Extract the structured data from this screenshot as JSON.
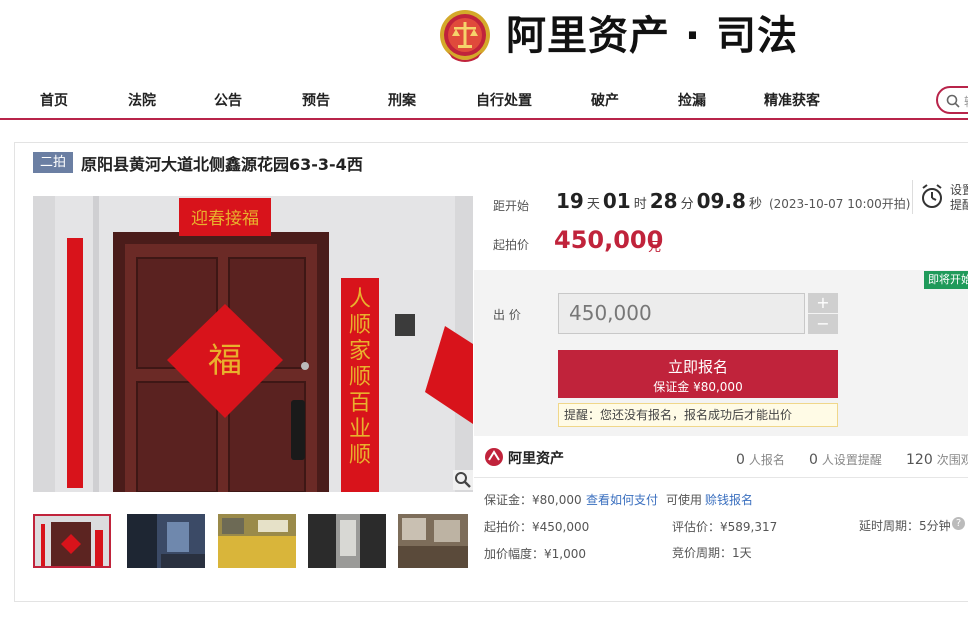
{
  "header": {
    "brand": "阿里资产 · 司法"
  },
  "nav": {
    "items": [
      "首页",
      "法院",
      "公告",
      "预告",
      "刑案",
      "自行处置",
      "破产",
      "捡漏",
      "精准获客"
    ],
    "search_placeholder": "输入"
  },
  "item": {
    "round_tag": "二拍",
    "title": "原阳县黄河大道北侧鑫源花园63-3-4西"
  },
  "countdown": {
    "label": "距开始",
    "days": "19",
    "days_unit": "天",
    "hours": "01",
    "hours_unit": "时",
    "minutes": "28",
    "minutes_unit": "分",
    "seconds": "09.8",
    "seconds_unit": "秒",
    "start_time": "(2023-10-07 10:00开拍)"
  },
  "start_price": {
    "label": "起拍价",
    "value": "450,000",
    "unit": "元"
  },
  "reminder": {
    "line1": "设置",
    "line2": "提醒"
  },
  "status_badge": "即将开始",
  "bid": {
    "label": "出 价",
    "value": "450,000",
    "plus": "+",
    "minus": "−",
    "signup_label": "立即报名",
    "deposit_label": "保证金 ¥80,000",
    "tip": "提醒：您还没有报名，报名成功后才能出价"
  },
  "stats": {
    "brand": "阿里资产",
    "signups": {
      "n": "0",
      "t": "人报名"
    },
    "reminders": {
      "n": "0",
      "t": "人设置提醒"
    },
    "views": {
      "n": "120",
      "t": "次围观"
    }
  },
  "details": {
    "deposit": "保证金：¥80,000",
    "how_to_pay": "查看如何支付",
    "usable": "可使用",
    "earn_deposit": "赊钱报名",
    "start_price": "起拍价：¥450,000",
    "appraisal": "评估价：¥589,317",
    "delay": "延时周期：5分钟",
    "increment": "加价幅度：¥1,000",
    "cycle": "竞价周期：1天"
  },
  "colors": {
    "accent": "#c0233b",
    "nav_line": "#b8244a",
    "round_tag": "#6b7fa3",
    "badge": "#1f9a5a"
  }
}
